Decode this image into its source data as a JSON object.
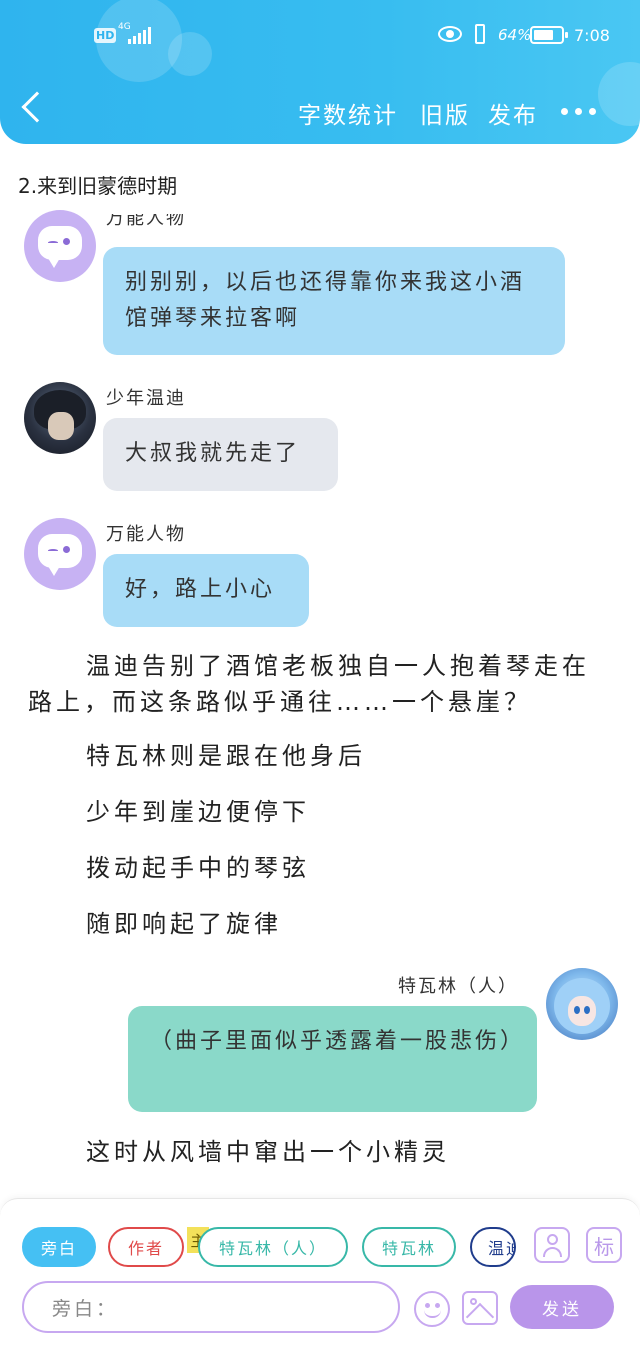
{
  "status_bar": {
    "hd": "HD",
    "network": "4G",
    "battery_pct": "64%",
    "time": "7:08"
  },
  "nav": {
    "word_count": "字数统计",
    "old_version": "旧版",
    "publish": "发布"
  },
  "chapter_title": "2.来到旧蒙德时期",
  "messages": [
    {
      "speaker": "万能人物",
      "text": "别别别，以后也还得靠你来我这小酒馆弹琴来拉客啊"
    },
    {
      "speaker": "少年温迪",
      "text": "大叔我就先走了"
    },
    {
      "speaker": "万能人物",
      "text": "好，路上小心"
    },
    {
      "speaker": "特瓦林（人）",
      "text": "（曲子里面似乎透露着一股悲伤）"
    }
  ],
  "narration": {
    "p1_line1": "温迪告别了酒馆老板独自一人抱着琴走在",
    "p1_line2": "路上，而这条路似乎通往……一个悬崖？",
    "p2": "特瓦林则是跟在他身后",
    "p3": "少年到崖边便停下",
    "p4": "拨动起手中的琴弦",
    "p5": "随即响起了旋律",
    "p6": "这时从风墙中窜出一个小精灵"
  },
  "panel": {
    "chips": {
      "narrator": "旁白",
      "author": "作者",
      "main_tag": "主",
      "tevalin_human": "特瓦林（人）",
      "tevalin": "特瓦林",
      "wendi_partial": "温迪"
    },
    "mark_label": "标",
    "input_placeholder": "旁白：",
    "send": "发送"
  },
  "colors": {
    "header": "#38bdf0",
    "bubble_blue": "#a8dcf7",
    "bubble_gray": "#e5e8ee",
    "bubble_green": "#8ad9c9",
    "accent_purple": "#b995ea"
  }
}
